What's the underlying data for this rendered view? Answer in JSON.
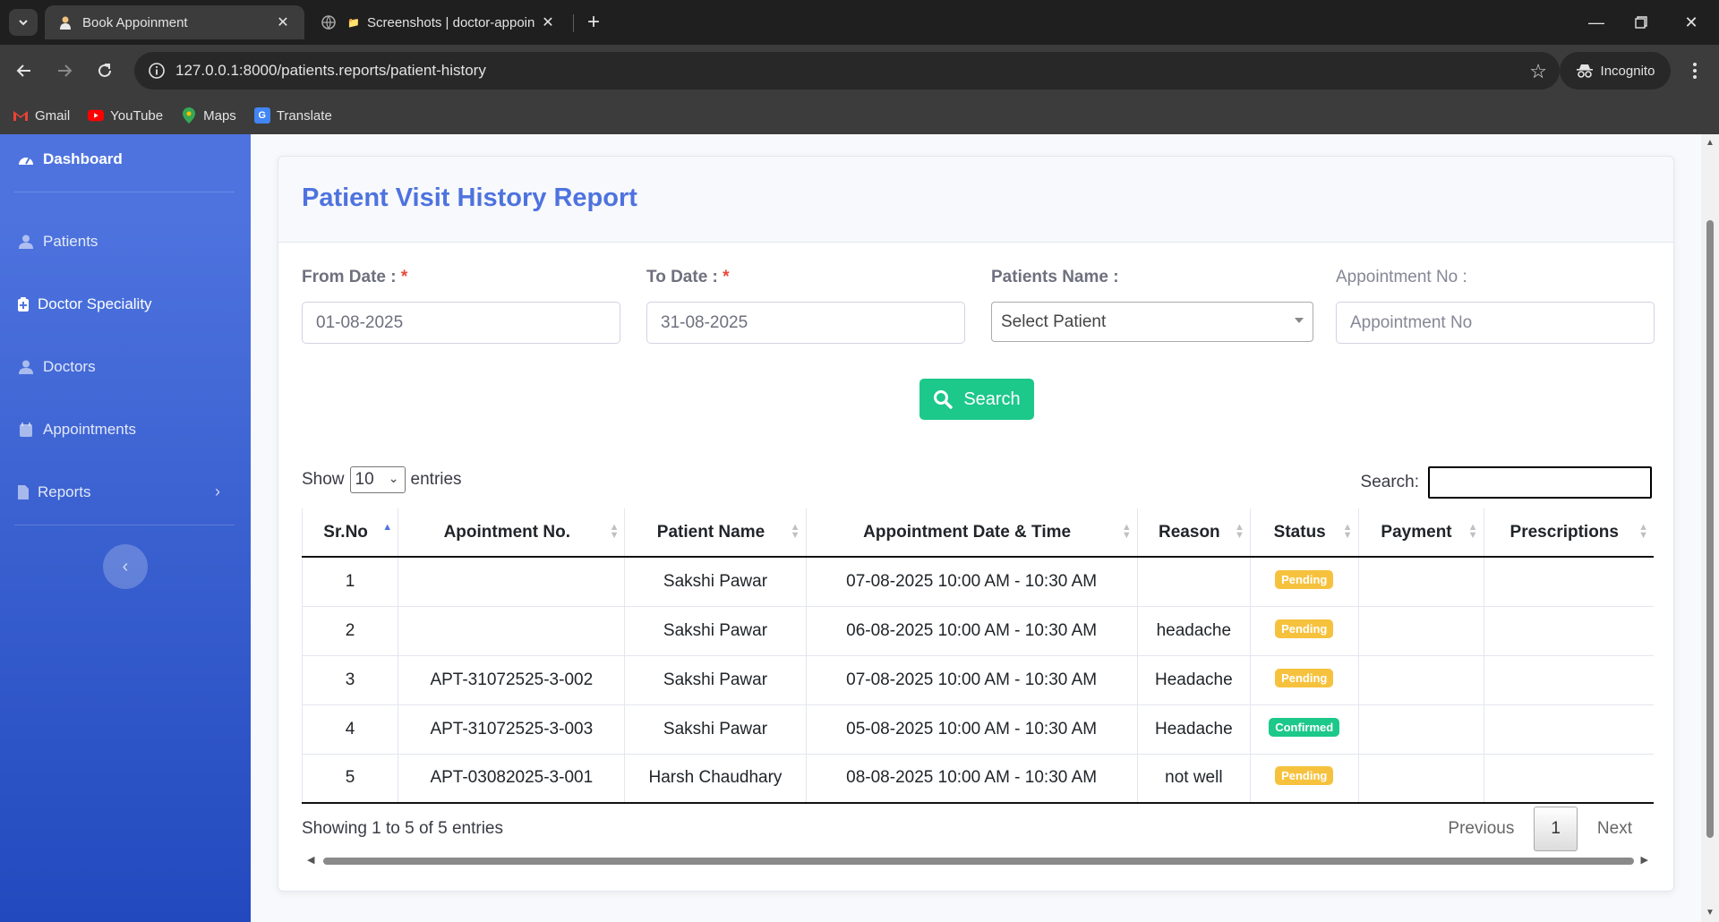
{
  "browser": {
    "tabs": [
      {
        "title": "Book Appoinment",
        "icon": "doctor-icon",
        "active": true
      },
      {
        "title": "Screenshots | doctor-appoin",
        "icon": "globe-icon",
        "active": false
      }
    ],
    "url": "127.0.0.1:8000/patients.reports/patient-history",
    "incognito_label": "Incognito",
    "bookmarks": [
      {
        "label": "Gmail",
        "icon": "gmail-icon",
        "color": "#ea4335"
      },
      {
        "label": "YouTube",
        "icon": "youtube-icon",
        "color": "#ff0000"
      },
      {
        "label": "Maps",
        "icon": "maps-icon",
        "color": "#34a853"
      },
      {
        "label": "Translate",
        "icon": "translate-icon",
        "color": "#4285f4"
      }
    ]
  },
  "sidebar": {
    "items": [
      {
        "label": "Dashboard",
        "icon": "dashboard-icon",
        "active": true
      },
      {
        "label": "Patients",
        "icon": "user-icon"
      },
      {
        "label": "Doctor Speciality",
        "icon": "medkit-icon"
      },
      {
        "label": "Doctors",
        "icon": "user-md-icon"
      },
      {
        "label": "Appointments",
        "icon": "calendar-icon"
      },
      {
        "label": "Reports",
        "icon": "file-icon",
        "has_submenu": true
      }
    ],
    "toggle_icon": "chevron-left-icon"
  },
  "page": {
    "title": "Patient Visit History Report",
    "filters": {
      "from_date": {
        "label": "From Date :",
        "required": "*",
        "value": "01-08-2025"
      },
      "to_date": {
        "label": "To Date :",
        "required": "*",
        "value": "31-08-2025"
      },
      "patient": {
        "label": "Patients Name :",
        "value": "Select Patient"
      },
      "appointment_no": {
        "label": "Appointment No :",
        "placeholder": "Appointment No"
      }
    },
    "search_button": "Search"
  },
  "table_controls": {
    "show_label": "Show",
    "entries_value": "10",
    "entries_label": "entries",
    "search_label": "Search:"
  },
  "table": {
    "columns": [
      "Sr.No",
      "Apointment No.",
      "Patient Name",
      "Appointment Date & Time",
      "Reason",
      "Status",
      "Payment",
      "Prescriptions"
    ],
    "rows": [
      {
        "sr": "1",
        "apt": "",
        "patient": "Sakshi Pawar",
        "datetime": "07-08-2025 10:00 AM - 10:30 AM",
        "reason": "",
        "status": "Pending",
        "payment": "",
        "prescriptions": ""
      },
      {
        "sr": "2",
        "apt": "",
        "patient": "Sakshi Pawar",
        "datetime": "06-08-2025 10:00 AM - 10:30 AM",
        "reason": "headache",
        "status": "Pending",
        "payment": "",
        "prescriptions": ""
      },
      {
        "sr": "3",
        "apt": "APT-31072525-3-002",
        "patient": "Sakshi Pawar",
        "datetime": "07-08-2025 10:00 AM - 10:30 AM",
        "reason": "Headache",
        "status": "Pending",
        "payment": "",
        "prescriptions": ""
      },
      {
        "sr": "4",
        "apt": "APT-31072525-3-003",
        "patient": "Sakshi Pawar",
        "datetime": "05-08-2025 10:00 AM - 10:30 AM",
        "reason": "Headache",
        "status": "Confirmed",
        "payment": "",
        "prescriptions": ""
      },
      {
        "sr": "5",
        "apt": "APT-03082025-3-001",
        "patient": "Harsh Chaudhary",
        "datetime": "08-08-2025 10:00 AM - 10:30 AM",
        "reason": "not well",
        "status": "Pending",
        "payment": "",
        "prescriptions": ""
      }
    ]
  },
  "footer": {
    "info": "Showing 1 to 5 of 5 entries",
    "previous": "Previous",
    "page": "1",
    "next": "Next"
  },
  "colors": {
    "primary": "#4e73df",
    "success": "#1cc88a",
    "warning": "#f6c23e",
    "danger": "#e74a3b"
  }
}
